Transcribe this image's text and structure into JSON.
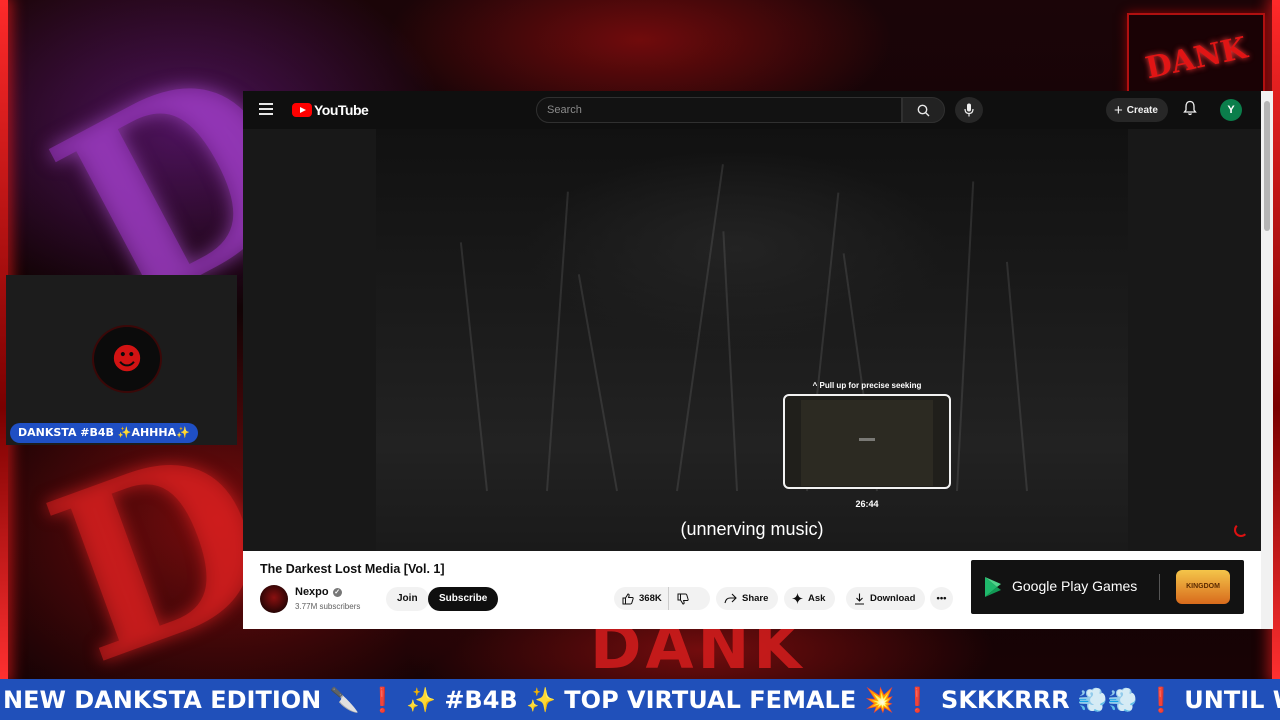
{
  "stream": {
    "background_letters": [
      "D",
      "D"
    ],
    "brand_text": "DANK",
    "corner_logo_text": "DANK",
    "cam_name": "DANKSTA #B4B ✨AHHHA✨",
    "ticker": "NEW DANKSTA EDITION 🔪 ❗ ✨ #B4B ✨ TOP VIRTUAL FEMALE 💥 ❗ SKKKRRR 💨💨 ❗ UNTIL WE RE"
  },
  "header": {
    "logo_text": "YouTube",
    "search_placeholder": "Search",
    "create_label": "Create",
    "avatar_letter": "Y"
  },
  "player": {
    "seek_hint": "^ Pull up for precise seeking",
    "seek_time": "26:44",
    "caption": "(unnerving music)"
  },
  "video": {
    "title": "The Darkest Lost Media [Vol. 1]",
    "channel": "Nexpo",
    "subscribers": "3.77M subscribers",
    "join_label": "Join",
    "subscribe_label": "Subscribe",
    "likes": "368K",
    "share_label": "Share",
    "ask_label": "Ask",
    "download_label": "Download"
  },
  "ad": {
    "text": "Google Play Games",
    "game_logo": "KINGDOM"
  },
  "colors": {
    "youtube_red": "#ff0000",
    "ticker_blue": "#2050ba",
    "stream_red": "#e01515"
  }
}
